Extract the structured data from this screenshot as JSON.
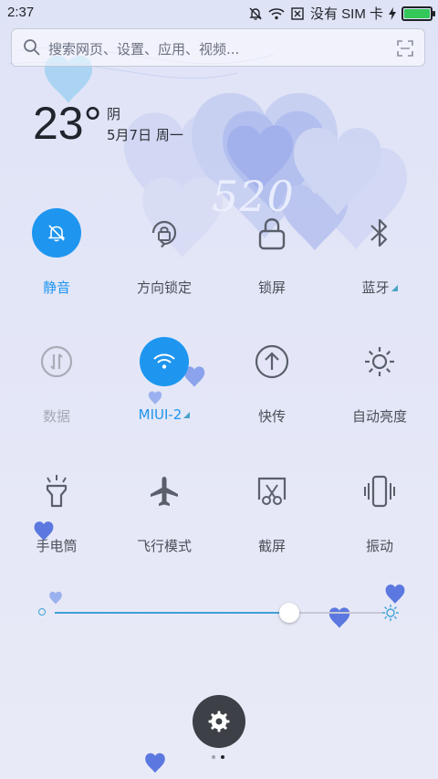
{
  "status_bar": {
    "time": "2:37",
    "carrier": "没有 SIM 卡",
    "icons": [
      "mute-bell-icon",
      "wifi-icon",
      "sim-x-icon",
      "charging-icon",
      "battery-icon"
    ]
  },
  "search": {
    "placeholder": "搜索网页、设置、应用、视频..."
  },
  "weather": {
    "temperature": "23°",
    "condition": "阴",
    "date": "5月7日 周一"
  },
  "wallpaper_text": "520",
  "toggles": {
    "mute": {
      "label": "静音",
      "state": "on"
    },
    "rotation_lock": {
      "label": "方向锁定",
      "state": "off"
    },
    "lock_screen": {
      "label": "锁屏",
      "state": "off"
    },
    "bluetooth": {
      "label": "蓝牙",
      "state": "off"
    },
    "data": {
      "label": "数据",
      "state": "disabled"
    },
    "wifi": {
      "label": "MIUI-2",
      "state": "on"
    },
    "transfer": {
      "label": "快传",
      "state": "off"
    },
    "auto_brightness": {
      "label": "自动亮度",
      "state": "off"
    },
    "flashlight": {
      "label": "手电筒",
      "state": "off"
    },
    "airplane": {
      "label": "飞行模式",
      "state": "off"
    },
    "screenshot": {
      "label": "截屏",
      "state": "off"
    },
    "vibrate": {
      "label": "振动",
      "state": "off"
    }
  },
  "brightness": {
    "level": 0.69
  },
  "pager": {
    "pages": 2,
    "current": 2
  },
  "colors": {
    "accent": "#1e96f0",
    "fab": "#3d4046",
    "hearts": "#5b78e0"
  }
}
